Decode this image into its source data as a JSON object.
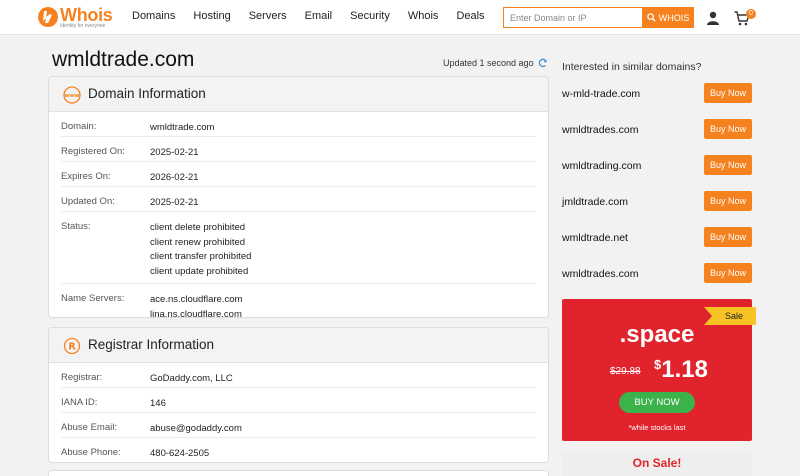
{
  "header": {
    "logo_text": "Whois",
    "logo_tagline": "Identity for everyone",
    "nav": [
      "Domains",
      "Hosting",
      "Servers",
      "Email",
      "Security",
      "Whois",
      "Deals"
    ],
    "search_placeholder": "Enter Domain or IP",
    "search_button": "WHOIS",
    "cart_count": "0"
  },
  "page": {
    "title": "wmldtrade.com",
    "updated": "Updated 1 second ago"
  },
  "domain_info": {
    "title": "Domain Information",
    "rows": [
      {
        "label": "Domain:",
        "value": [
          "wmldtrade.com"
        ]
      },
      {
        "label": "Registered On:",
        "value": [
          "2025-02-21"
        ]
      },
      {
        "label": "Expires On:",
        "value": [
          "2026-02-21"
        ]
      },
      {
        "label": "Updated On:",
        "value": [
          "2025-02-21"
        ]
      },
      {
        "label": "Status:",
        "value": [
          "client delete prohibited",
          "client renew prohibited",
          "client transfer prohibited",
          "client update prohibited"
        ]
      },
      {
        "label": "Name Servers:",
        "value": [
          "ace.ns.cloudflare.com",
          "lina.ns.cloudflare.com"
        ]
      }
    ]
  },
  "registrar_info": {
    "title": "Registrar Information",
    "rows": [
      {
        "label": "Registrar:",
        "value": [
          "GoDaddy.com, LLC"
        ]
      },
      {
        "label": "IANA ID:",
        "value": [
          "146"
        ]
      },
      {
        "label": "Abuse Email:",
        "value": [
          "abuse@godaddy.com"
        ]
      },
      {
        "label": "Abuse Phone:",
        "value": [
          "480-624-2505"
        ]
      }
    ]
  },
  "similar": {
    "title": "Interested in similar domains?",
    "buy_label": "Buy Now",
    "domains": [
      "w-mld-trade.com",
      "wmldtrades.com",
      "wmldtrading.com",
      "jmldtrade.com",
      "wmldtrade.net",
      "wmldtrades.com"
    ]
  },
  "promo": {
    "ribbon": "Sale",
    "tld": ".space",
    "old_price": "$29.88",
    "currency": "$",
    "new_price": "1.18",
    "button": "BUY NOW",
    "note": "*while stocks last"
  },
  "onsale": {
    "title": "On Sale!"
  },
  "colors": {
    "accent": "#f5821f",
    "promo_bg": "#e0232c",
    "promo_button": "#3bb34a",
    "ribbon": "#f7c324"
  }
}
